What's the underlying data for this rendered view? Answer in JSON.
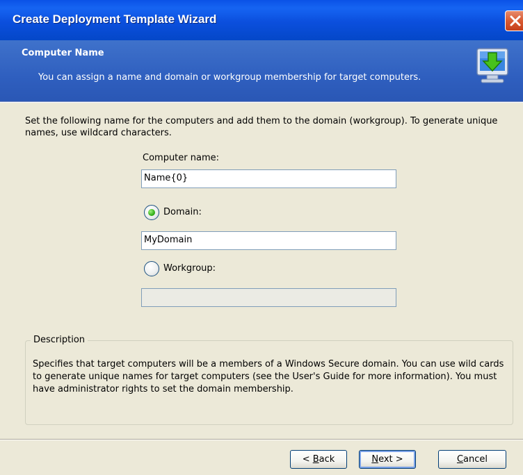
{
  "window": {
    "title": "Create Deployment Template Wizard"
  },
  "header": {
    "title": "Computer Name",
    "subtitle": "You can assign a name and domain or workgroup membership for target computers."
  },
  "main": {
    "instruction": "Set the following name for the computers and add them to the domain (workgroup). To generate unique names, use wildcard characters.",
    "computer_name_label": "Computer name:",
    "computer_name_value": "Name{0}",
    "domain_label": "Domain:",
    "domain_selected": true,
    "domain_value": "MyDomain",
    "workgroup_label": "Workgroup:",
    "workgroup_selected": false,
    "workgroup_value": ""
  },
  "description": {
    "legend": "Description",
    "text": "Specifies that target computers will be a members of a Windows Secure domain. You can use wild cards to generate unique names for target computers (see the User's Guide for more information). You must have administrator rights to set the domain membership."
  },
  "buttons": {
    "back_prefix": "< ",
    "back_key": "B",
    "back_rest": "ack",
    "next_key": "N",
    "next_rest": "ext >",
    "cancel_key": "C",
    "cancel_rest": "ancel"
  },
  "colors": {
    "title_bar": "#0a52e6",
    "header_band": "#2f5fbf",
    "dialog_bg": "#ece9d8",
    "radio_selected": "#35b01a"
  },
  "icons": {
    "close": "close-icon",
    "header": "computer-download-icon"
  }
}
